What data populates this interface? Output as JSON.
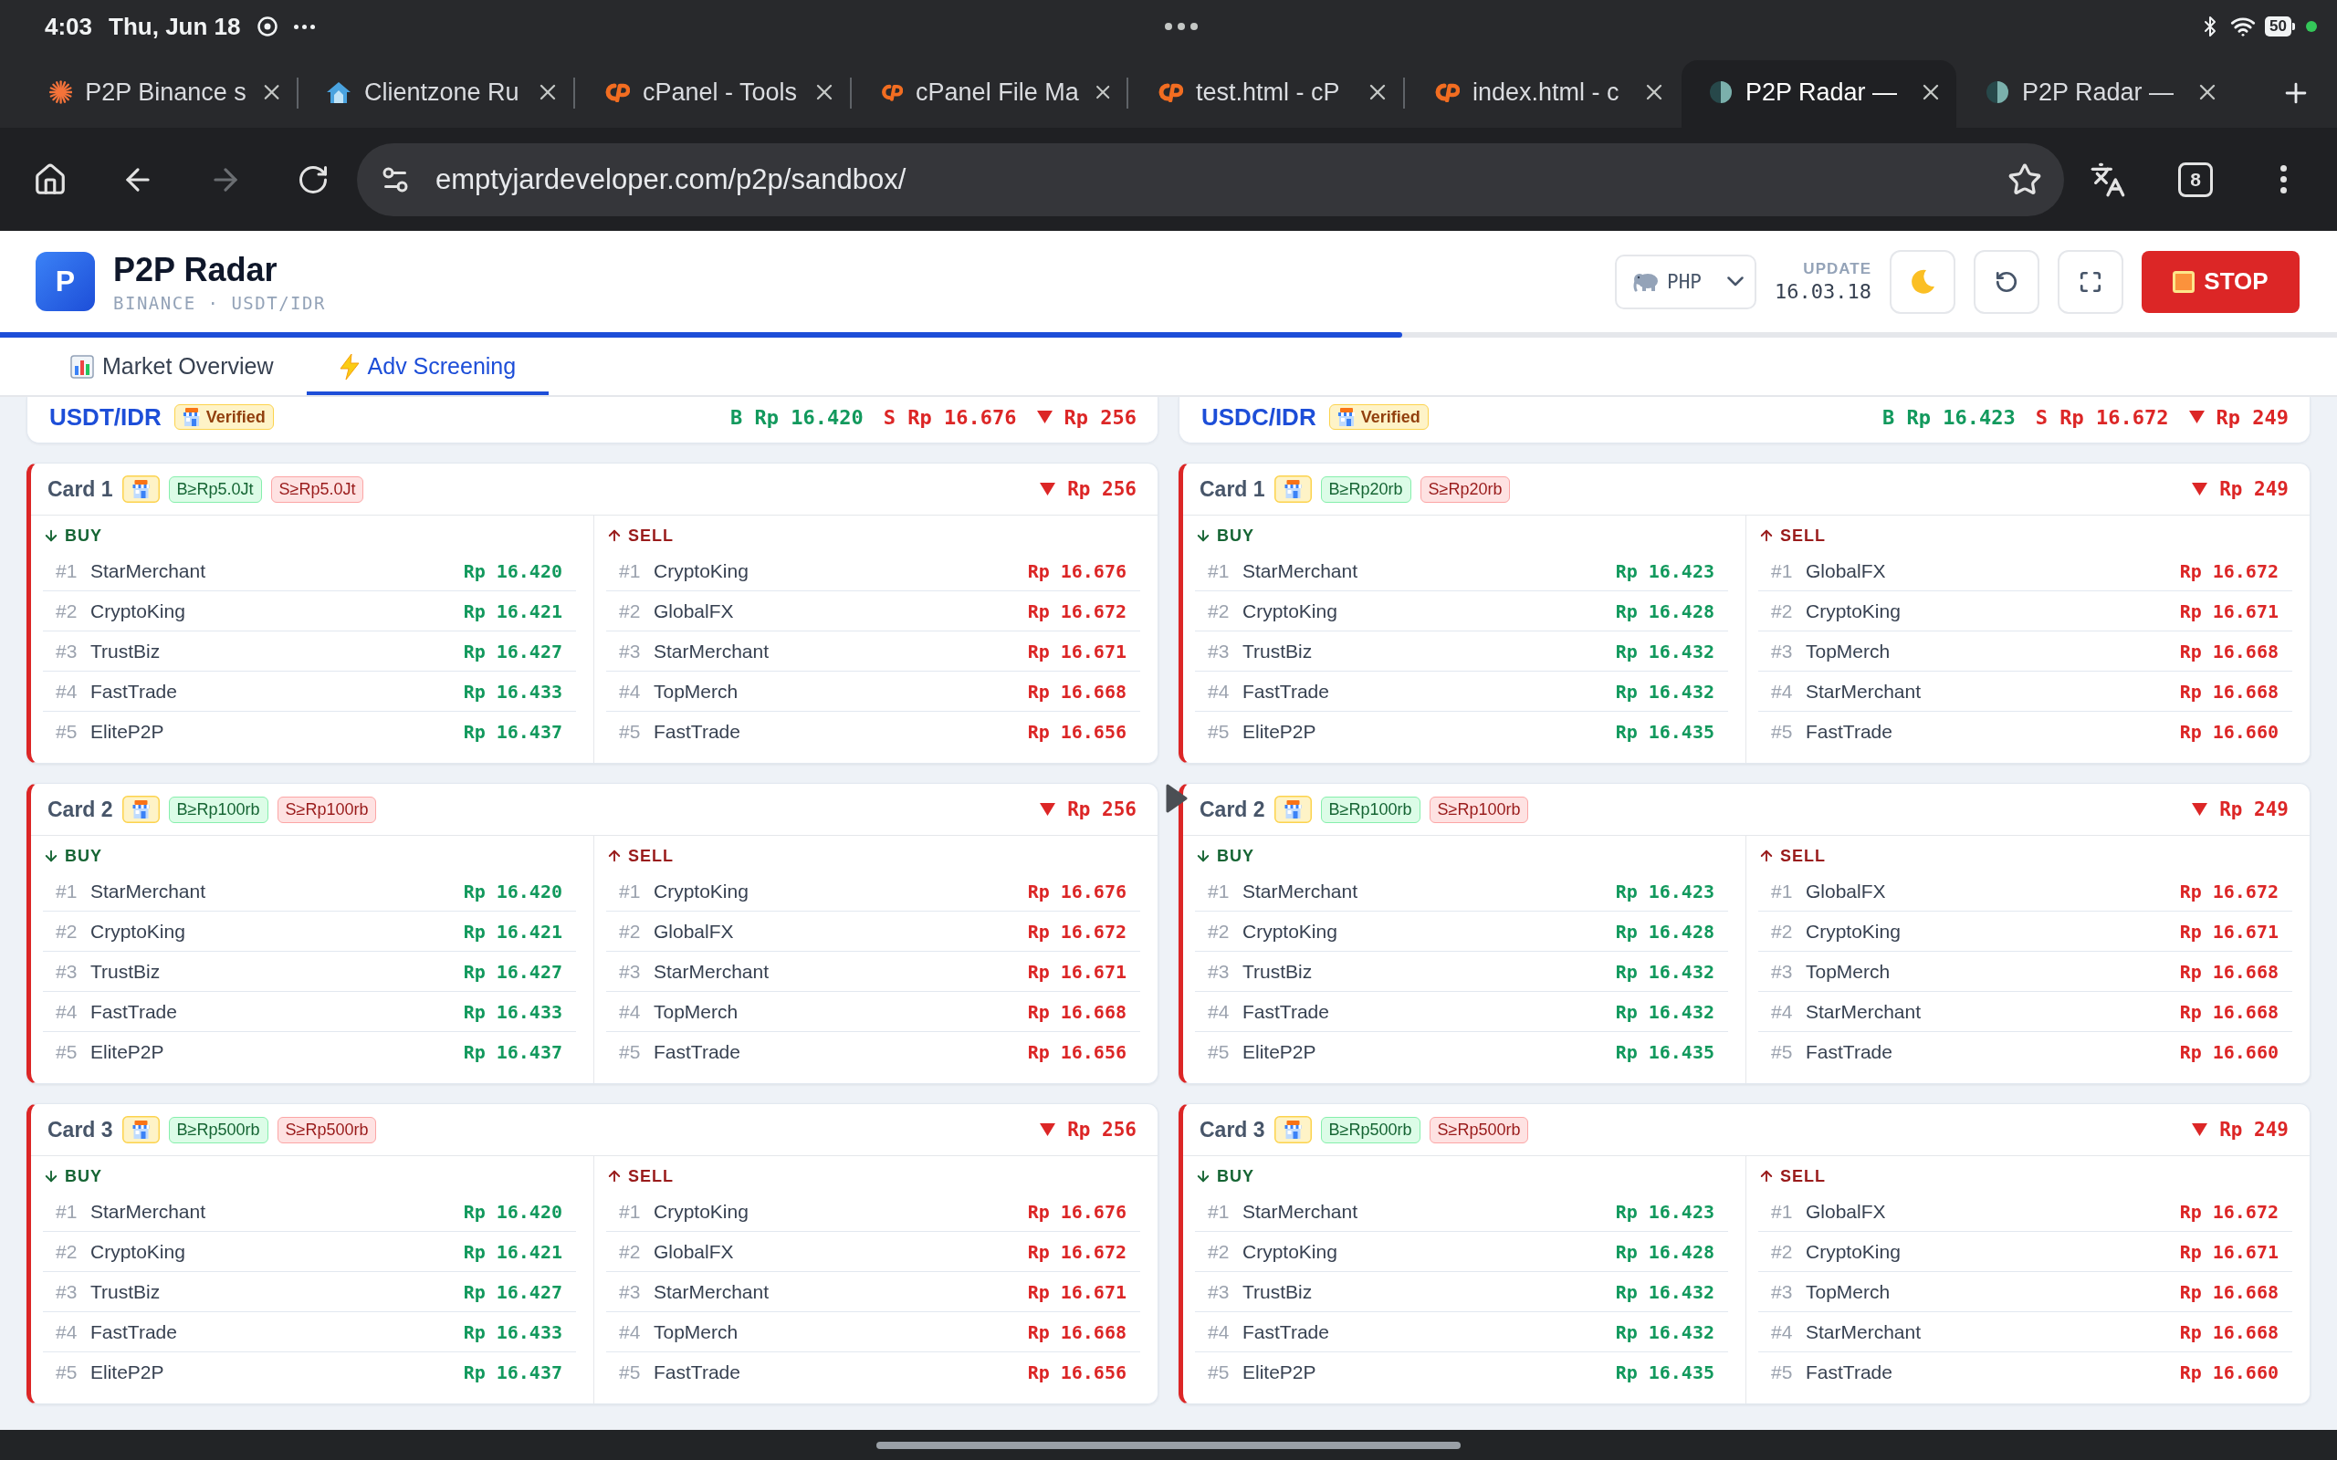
{
  "status_bar": {
    "time": "4:03",
    "date": "Thu, Jun 18",
    "battery": "50"
  },
  "browser_tabs": [
    {
      "kind": "sunburst",
      "title": "P2P Binance s",
      "selected": false
    },
    {
      "kind": "house",
      "title": "Clientzone Ru",
      "selected": false
    },
    {
      "kind": "cp",
      "title": "cPanel - Tools",
      "selected": false
    },
    {
      "kind": "cp",
      "title": "cPanel File Ma",
      "selected": false
    },
    {
      "kind": "cp",
      "title": "test.html - cP",
      "selected": false
    },
    {
      "kind": "cp",
      "title": "index.html - c",
      "selected": false
    },
    {
      "kind": "disc",
      "title": "P2P Radar —",
      "selected": true
    },
    {
      "kind": "disc",
      "title": "P2P Radar —",
      "selected": false
    }
  ],
  "toolbar": {
    "forward_disabled": true,
    "url": "emptyjardeveloper.com/p2p/sandbox/",
    "tab_count": "8"
  },
  "app_header": {
    "logo_letter": "P",
    "title": "P2P Radar",
    "subtitle": "BINANCE · USDT/IDR",
    "currency": "PHP",
    "update_label": "UPDATE",
    "update_time": "16.03.18",
    "stop_label": "STOP"
  },
  "refresh_progress": {
    "level": 0.6
  },
  "tabs": [
    {
      "label": "Market Overview",
      "selected": false
    },
    {
      "label": "Adv Screening",
      "selected": true
    }
  ],
  "markets": [
    {
      "pair": "USDT/IDR",
      "badge": "Verified",
      "buy": "B Rp 16.420",
      "sell": "S Rp 16.676",
      "spread": "Rp 256",
      "cards": [
        {
          "title": "Card 1",
          "buy_filter": "B≥Rp5.0Jt",
          "sell_filter": "S≥Rp5.0Jt",
          "spread": "Rp 256",
          "buy_label": "BUY",
          "sell_label": "SELL",
          "buy_offers": [
            {
              "rank": "#1",
              "name": "StarMerchant",
              "price": "Rp 16.420"
            },
            {
              "rank": "#2",
              "name": "CryptoKing",
              "price": "Rp 16.421"
            },
            {
              "rank": "#3",
              "name": "TrustBiz",
              "price": "Rp 16.427"
            },
            {
              "rank": "#4",
              "name": "FastTrade",
              "price": "Rp 16.433"
            },
            {
              "rank": "#5",
              "name": "EliteP2P",
              "price": "Rp 16.437"
            }
          ],
          "sell_offers": [
            {
              "rank": "#1",
              "name": "CryptoKing",
              "price": "Rp 16.676"
            },
            {
              "rank": "#2",
              "name": "GlobalFX",
              "price": "Rp 16.672"
            },
            {
              "rank": "#3",
              "name": "StarMerchant",
              "price": "Rp 16.671"
            },
            {
              "rank": "#4",
              "name": "TopMerch",
              "price": "Rp 16.668"
            },
            {
              "rank": "#5",
              "name": "FastTrade",
              "price": "Rp 16.656"
            }
          ]
        },
        {
          "title": "Card 2",
          "buy_filter": "B≥Rp100rb",
          "sell_filter": "S≥Rp100rb",
          "spread": "Rp 256",
          "buy_label": "BUY",
          "sell_label": "SELL",
          "buy_offers": [
            {
              "rank": "#1",
              "name": "StarMerchant",
              "price": "Rp 16.420"
            },
            {
              "rank": "#2",
              "name": "CryptoKing",
              "price": "Rp 16.421"
            },
            {
              "rank": "#3",
              "name": "TrustBiz",
              "price": "Rp 16.427"
            },
            {
              "rank": "#4",
              "name": "FastTrade",
              "price": "Rp 16.433"
            },
            {
              "rank": "#5",
              "name": "EliteP2P",
              "price": "Rp 16.437"
            }
          ],
          "sell_offers": [
            {
              "rank": "#1",
              "name": "CryptoKing",
              "price": "Rp 16.676"
            },
            {
              "rank": "#2",
              "name": "GlobalFX",
              "price": "Rp 16.672"
            },
            {
              "rank": "#3",
              "name": "StarMerchant",
              "price": "Rp 16.671"
            },
            {
              "rank": "#4",
              "name": "TopMerch",
              "price": "Rp 16.668"
            },
            {
              "rank": "#5",
              "name": "FastTrade",
              "price": "Rp 16.656"
            }
          ]
        },
        {
          "title": "Card 3",
          "buy_filter": "B≥Rp500rb",
          "sell_filter": "S≥Rp500rb",
          "spread": "Rp 256",
          "buy_label": "BUY",
          "sell_label": "SELL",
          "buy_offers": [
            {
              "rank": "#1",
              "name": "StarMerchant",
              "price": "Rp 16.420"
            },
            {
              "rank": "#2",
              "name": "CryptoKing",
              "price": "Rp 16.421"
            },
            {
              "rank": "#3",
              "name": "TrustBiz",
              "price": "Rp 16.427"
            },
            {
              "rank": "#4",
              "name": "FastTrade",
              "price": "Rp 16.433"
            },
            {
              "rank": "#5",
              "name": "EliteP2P",
              "price": "Rp 16.437"
            }
          ],
          "sell_offers": [
            {
              "rank": "#1",
              "name": "CryptoKing",
              "price": "Rp 16.676"
            },
            {
              "rank": "#2",
              "name": "GlobalFX",
              "price": "Rp 16.672"
            },
            {
              "rank": "#3",
              "name": "StarMerchant",
              "price": "Rp 16.671"
            },
            {
              "rank": "#4",
              "name": "TopMerch",
              "price": "Rp 16.668"
            },
            {
              "rank": "#5",
              "name": "FastTrade",
              "price": "Rp 16.656"
            }
          ]
        }
      ]
    },
    {
      "pair": "USDC/IDR",
      "badge": "Verified",
      "buy": "B Rp 16.423",
      "sell": "S Rp 16.672",
      "spread": "Rp 249",
      "cards": [
        {
          "title": "Card 1",
          "buy_filter": "B≥Rp20rb",
          "sell_filter": "S≥Rp20rb",
          "spread": "Rp 249",
          "buy_label": "BUY",
          "sell_label": "SELL",
          "buy_offers": [
            {
              "rank": "#1",
              "name": "StarMerchant",
              "price": "Rp 16.423"
            },
            {
              "rank": "#2",
              "name": "CryptoKing",
              "price": "Rp 16.428"
            },
            {
              "rank": "#3",
              "name": "TrustBiz",
              "price": "Rp 16.432"
            },
            {
              "rank": "#4",
              "name": "FastTrade",
              "price": "Rp 16.432"
            },
            {
              "rank": "#5",
              "name": "EliteP2P",
              "price": "Rp 16.435"
            }
          ],
          "sell_offers": [
            {
              "rank": "#1",
              "name": "GlobalFX",
              "price": "Rp 16.672"
            },
            {
              "rank": "#2",
              "name": "CryptoKing",
              "price": "Rp 16.671"
            },
            {
              "rank": "#3",
              "name": "TopMerch",
              "price": "Rp 16.668"
            },
            {
              "rank": "#4",
              "name": "StarMerchant",
              "price": "Rp 16.668"
            },
            {
              "rank": "#5",
              "name": "FastTrade",
              "price": "Rp 16.660"
            }
          ]
        },
        {
          "title": "Card 2",
          "buy_filter": "B≥Rp100rb",
          "sell_filter": "S≥Rp100rb",
          "spread": "Rp 249",
          "buy_label": "BUY",
          "sell_label": "SELL",
          "buy_offers": [
            {
              "rank": "#1",
              "name": "StarMerchant",
              "price": "Rp 16.423"
            },
            {
              "rank": "#2",
              "name": "CryptoKing",
              "price": "Rp 16.428"
            },
            {
              "rank": "#3",
              "name": "TrustBiz",
              "price": "Rp 16.432"
            },
            {
              "rank": "#4",
              "name": "FastTrade",
              "price": "Rp 16.432"
            },
            {
              "rank": "#5",
              "name": "EliteP2P",
              "price": "Rp 16.435"
            }
          ],
          "sell_offers": [
            {
              "rank": "#1",
              "name": "GlobalFX",
              "price": "Rp 16.672"
            },
            {
              "rank": "#2",
              "name": "CryptoKing",
              "price": "Rp 16.671"
            },
            {
              "rank": "#3",
              "name": "TopMerch",
              "price": "Rp 16.668"
            },
            {
              "rank": "#4",
              "name": "StarMerchant",
              "price": "Rp 16.668"
            },
            {
              "rank": "#5",
              "name": "FastTrade",
              "price": "Rp 16.660"
            }
          ]
        },
        {
          "title": "Card 3",
          "buy_filter": "B≥Rp500rb",
          "sell_filter": "S≥Rp500rb",
          "spread": "Rp 249",
          "buy_label": "BUY",
          "sell_label": "SELL",
          "buy_offers": [
            {
              "rank": "#1",
              "name": "StarMerchant",
              "price": "Rp 16.423"
            },
            {
              "rank": "#2",
              "name": "CryptoKing",
              "price": "Rp 16.428"
            },
            {
              "rank": "#3",
              "name": "TrustBiz",
              "price": "Rp 16.432"
            },
            {
              "rank": "#4",
              "name": "FastTrade",
              "price": "Rp 16.432"
            },
            {
              "rank": "#5",
              "name": "EliteP2P",
              "price": "Rp 16.435"
            }
          ],
          "sell_offers": [
            {
              "rank": "#1",
              "name": "GlobalFX",
              "price": "Rp 16.672"
            },
            {
              "rank": "#2",
              "name": "CryptoKing",
              "price": "Rp 16.671"
            },
            {
              "rank": "#3",
              "name": "TopMerch",
              "price": "Rp 16.668"
            },
            {
              "rank": "#4",
              "name": "StarMerchant",
              "price": "Rp 16.668"
            },
            {
              "rank": "#5",
              "name": "FastTrade",
              "price": "Rp 16.660"
            }
          ]
        }
      ]
    }
  ]
}
